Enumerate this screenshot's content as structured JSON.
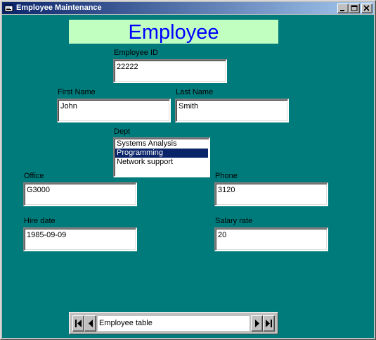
{
  "window": {
    "title": "Employee Maintenance",
    "title_color": "#0a246a",
    "client_color": "#007b7b"
  },
  "banner": {
    "text": "Employee",
    "bg": "#c0ffc0",
    "fg": "#0000ff"
  },
  "fields": {
    "employee_id": {
      "label": "Employee ID",
      "value": "22222"
    },
    "first_name": {
      "label": "First Name",
      "value": "John"
    },
    "last_name": {
      "label": "Last Name",
      "value": "Smith"
    },
    "office": {
      "label": "Office",
      "value": "G3000"
    },
    "phone": {
      "label": "Phone",
      "value": "3120"
    },
    "hire_date": {
      "label": "Hire date",
      "value": "1985-09-09"
    },
    "salary_rate": {
      "label": "Salary rate",
      "value": "20"
    }
  },
  "dept": {
    "label": "Dept",
    "options": [
      "Systems Analysis",
      "Programming",
      "Network support"
    ],
    "selected": "Programming"
  },
  "data_control": {
    "caption": "Employee table",
    "icons": [
      "first-record-icon",
      "prev-record-icon",
      "next-record-icon",
      "last-record-icon"
    ]
  },
  "titlebar_buttons": [
    "minimize-icon",
    "maximize-icon",
    "close-icon"
  ]
}
